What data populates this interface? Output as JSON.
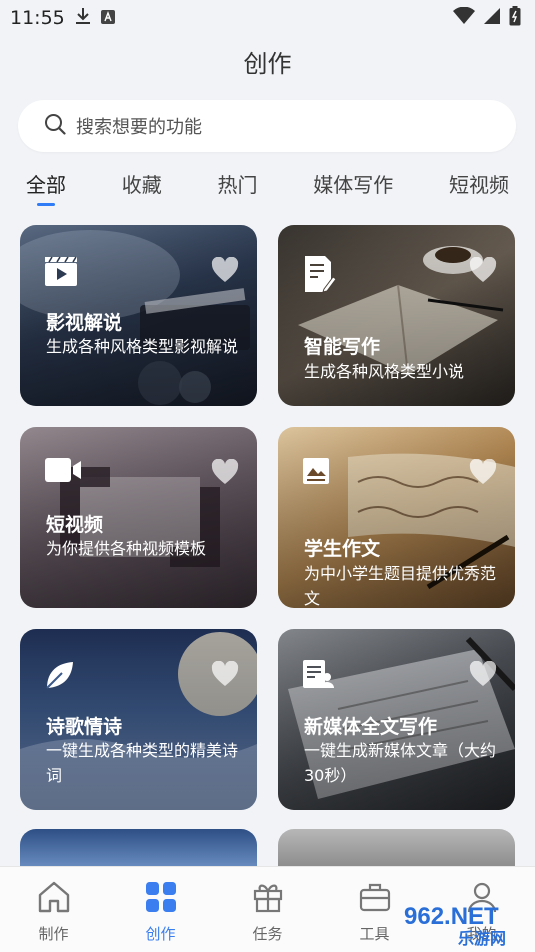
{
  "status_bar": {
    "time": "11:55"
  },
  "header": {
    "title": "创作"
  },
  "search": {
    "placeholder": "搜索想要的功能"
  },
  "tabs": [
    {
      "label": "全部",
      "active": true
    },
    {
      "label": "收藏"
    },
    {
      "label": "热门"
    },
    {
      "label": "媒体写作"
    },
    {
      "label": "短视频"
    }
  ],
  "cards": [
    {
      "title": "影视解说",
      "desc": "生成各种风格类型影视解说",
      "icon": "clapperboard-icon"
    },
    {
      "title": "智能写作",
      "desc": "生成各种风格类型小说",
      "icon": "edit-document-icon"
    },
    {
      "title": "短视频",
      "desc": "为你提供各种视频模板",
      "icon": "video-camera-icon"
    },
    {
      "title": "学生作文",
      "desc": "为中小学生题目提供优秀范文",
      "icon": "image-document-icon"
    },
    {
      "title": "诗歌情诗",
      "desc": "一键生成各种类型的精美诗词",
      "icon": "leaf-icon"
    },
    {
      "title": "新媒体全文写作",
      "desc": "一键生成新媒体文章（大约30秒）",
      "icon": "user-document-icon"
    }
  ],
  "bottom_nav": [
    {
      "label": "制作",
      "icon": "home-icon"
    },
    {
      "label": "创作",
      "icon": "grid-icon",
      "active": true
    },
    {
      "label": "任务",
      "icon": "gift-icon"
    },
    {
      "label": "工具",
      "icon": "toolbox-icon"
    },
    {
      "label": "我的",
      "icon": "user-icon"
    }
  ],
  "watermark": {
    "text": "962.NET",
    "subtext": "乐游网"
  },
  "colors": {
    "accent": "#2f7cf6",
    "background": "#f1f3f6"
  }
}
